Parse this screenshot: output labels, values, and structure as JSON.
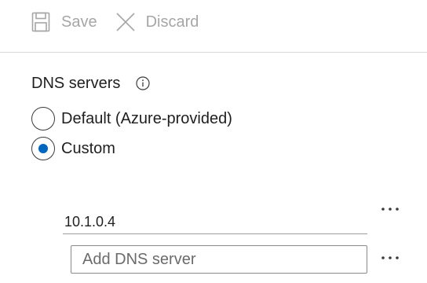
{
  "toolbar": {
    "save_label": "Save",
    "save_icon": "save-icon",
    "discard_label": "Discard",
    "discard_icon": "close-icon",
    "disabled_color": "#a6a6a6"
  },
  "dns": {
    "title": "DNS servers",
    "info_icon": "info-icon",
    "options": [
      {
        "label": "Default (Azure-provided)",
        "selected": false
      },
      {
        "label": "Custom",
        "selected": true
      }
    ],
    "accent_color": "#0067c0",
    "servers": [
      {
        "address": "10.1.0.4",
        "menu_icon": "more-icon"
      }
    ],
    "add_server": {
      "value": "",
      "placeholder": "Add DNS server",
      "menu_icon": "more-icon"
    }
  }
}
